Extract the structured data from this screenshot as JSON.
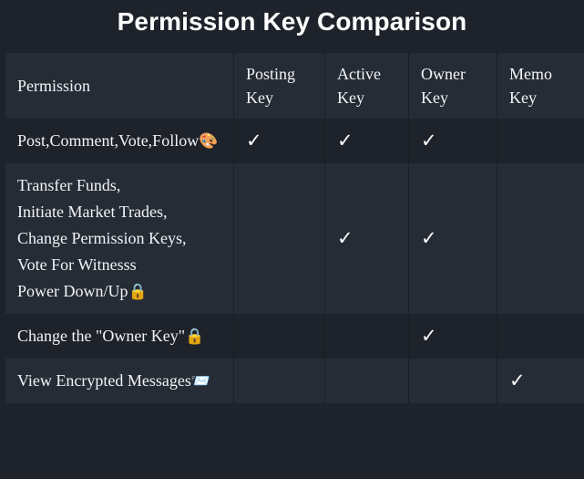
{
  "title": "Permission Key Comparison",
  "theme": {
    "page_bg": "#1e232b",
    "row_light_bg": "#262c35",
    "row_dark_bg": "#1e232b",
    "text": "#f2f4f7",
    "title_text": "#ffffff",
    "check_color": "#ffffff",
    "divider": "#1a1f26"
  },
  "table": {
    "columns": [
      {
        "key": "permission",
        "label": "Permission"
      },
      {
        "key": "posting",
        "label": "Posting Key"
      },
      {
        "key": "active",
        "label": "Active Key"
      },
      {
        "key": "owner",
        "label": "Owner Key"
      },
      {
        "key": "memo",
        "label": "Memo Key"
      }
    ],
    "check_glyph": "✓",
    "rows": [
      {
        "permission": "Post,Comment,Vote,Follow",
        "emoji": "🎨",
        "emoji_name": "artist-palette-emoji",
        "posting": "✓",
        "active": "✓",
        "owner": "✓",
        "memo": ""
      },
      {
        "permission": "Transfer Funds,\nInitiate Market Trades,\nChange Permission Keys,\nVote For Witnesss\nPower Down/Up",
        "emoji": "🔒",
        "emoji_name": "locked-emoji",
        "posting": "",
        "active": "✓",
        "owner": "✓",
        "memo": ""
      },
      {
        "permission": "Change the \"Owner Key\"",
        "emoji": "🔒",
        "emoji_name": "locked-emoji",
        "posting": "",
        "active": "",
        "owner": "✓",
        "memo": ""
      },
      {
        "permission": "View Encrypted Messages",
        "emoji": "📨",
        "emoji_name": "incoming-envelope-emoji",
        "posting": "",
        "active": "",
        "owner": "",
        "memo": "✓"
      }
    ]
  }
}
